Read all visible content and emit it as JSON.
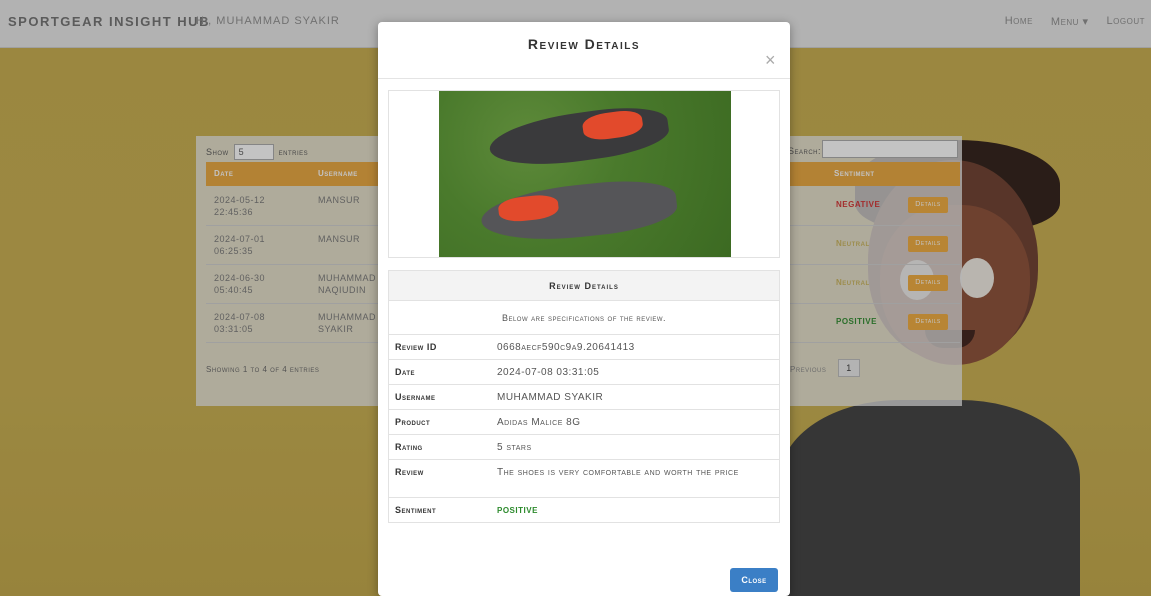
{
  "nav": {
    "brand": "SPORTGEAR INSIGHT HUB",
    "greeting": "Hi, MUHAMMAD SYAKIR",
    "links": [
      "Home",
      "Menu ▾",
      "Logout"
    ]
  },
  "table": {
    "show_label": "Show",
    "entries_value": "5",
    "entries_label": "entries",
    "search_label": "Search:",
    "headers": [
      "Date",
      "Username",
      "Sentiment",
      ""
    ],
    "rows": [
      {
        "date": "2024-05-12 22:45:36",
        "username": "MANSUR",
        "sentiment": "NEGATIVE",
        "sentiment_color": "#d32f2f",
        "action": "Details"
      },
      {
        "date": "2024-07-01 06:25:35",
        "username": "MANSUR",
        "sentiment": "Neutral",
        "sentiment_color": "#c9b35a",
        "action": "Details"
      },
      {
        "date": "2024-06-30 05:40:45",
        "username": "MUHAMMAD NAQIUDIN",
        "sentiment": "Neutral",
        "sentiment_color": "#c9b35a",
        "action": "Details"
      },
      {
        "date": "2024-07-08 03:31:05",
        "username": "MUHAMMAD SYAKIR",
        "sentiment": "POSITIVE",
        "sentiment_color": "#2c8a2c",
        "action": "Details"
      }
    ],
    "footer_info": "Showing 1 to 4 of 4 entries",
    "prev_label": "Previous",
    "page": "1"
  },
  "modal": {
    "title": "Review Details",
    "close_x": "×",
    "section_title": "Review Details",
    "subtitle": "Below are specifications of the review.",
    "fields": [
      {
        "label": "Review ID",
        "value": "0668aecf590c9a9.20641413"
      },
      {
        "label": "Date",
        "value": "2024-07-08 03:31:05"
      },
      {
        "label": "Username",
        "value": "MUHAMMAD SYAKIR"
      },
      {
        "label": "Product",
        "value": "Adidas Malice 8G"
      },
      {
        "label": "Rating",
        "value": "5 stars"
      },
      {
        "label": "Review",
        "value": "The shoes is very comfortable and worth the price"
      },
      {
        "label": "Sentiment",
        "value": "POSITIVE"
      }
    ],
    "close_button": "Close"
  },
  "colors": {
    "accent_orange": "#e9a53a",
    "close_blue": "#3b7fc6",
    "positive_green": "#2c8a2c"
  }
}
